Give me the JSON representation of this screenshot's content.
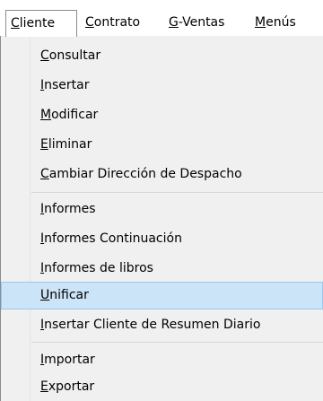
{
  "menubar": {
    "items": [
      {
        "ul": "C",
        "rest": "liente"
      },
      {
        "ul": "C",
        "rest": "ontrato"
      },
      {
        "ul": "G",
        "rest": "-Ventas"
      },
      {
        "ul": "M",
        "rest": "enús"
      }
    ]
  },
  "dropdown": {
    "items": [
      {
        "ul": "C",
        "rest": "onsultar"
      },
      {
        "ul": "I",
        "rest": "nsertar"
      },
      {
        "ul": "M",
        "rest": "odificar"
      },
      {
        "ul": "E",
        "rest": "liminar"
      },
      {
        "ul": "C",
        "rest": "ambiar Dirección de Despacho"
      },
      {
        "ul": "I",
        "rest": "nformes"
      },
      {
        "ul": "I",
        "rest": "nformes Continuación"
      },
      {
        "ul": "I",
        "rest": "nformes de libros"
      },
      {
        "ul": "U",
        "rest": "nificar"
      },
      {
        "ul": "I",
        "rest": "nsertar Cliente de Resumen Diario"
      },
      {
        "ul": "I",
        "rest": "mportar"
      },
      {
        "ul": "E",
        "rest": "xportar"
      }
    ]
  }
}
